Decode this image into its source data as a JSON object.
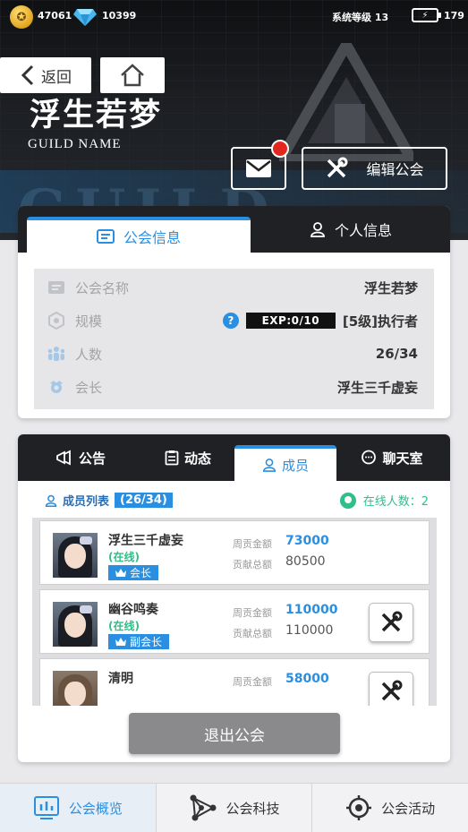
{
  "status_bar": {
    "coins": "47061",
    "gems": "10399",
    "system_level": "系统等级 13",
    "battery": "179"
  },
  "nav": {
    "back_label": "返回"
  },
  "guild": {
    "name": "浮生若梦",
    "subtitle": "GUILD NAME",
    "bg_word": "GUILD"
  },
  "header_actions": {
    "edit_label": "编辑公会"
  },
  "info_tabs": {
    "guild_info": "公会信息",
    "personal_info": "个人信息"
  },
  "info": {
    "name_label": "公会名称",
    "name_value": "浮生若梦",
    "scale_label": "规模",
    "exp_text": "EXP:0/10",
    "scale_value": "[5级]执行者",
    "members_label": "人数",
    "members_value": "26/34",
    "leader_label": "会长",
    "leader_value": "浮生三千虚妄"
  },
  "member_tabs": {
    "notice": "公告",
    "dynamic": "动态",
    "members": "成员",
    "chat": "聊天室"
  },
  "member_list": {
    "title": "成员列表",
    "count": "(26/34)",
    "online_label": "在线人数：2",
    "weekly_label": "周贡金额",
    "total_label": "贡献总额",
    "members": [
      {
        "name": "浮生三千虚妄",
        "status": "(在线)",
        "role": "会长",
        "weekly": "73000",
        "total": "80500"
      },
      {
        "name": "幽谷鸣奏",
        "status": "(在线)",
        "role": "副会长",
        "weekly": "110000",
        "total": "110000"
      },
      {
        "name": "清明",
        "status": "",
        "role": "",
        "weekly": "58000",
        "total": ""
      }
    ]
  },
  "quit_label": "退出公会",
  "bottom_nav": {
    "overview": "公会概览",
    "tech": "公会科技",
    "activity": "公会活动"
  },
  "colors": {
    "accent": "#2a8fe0",
    "online": "#2fbf88",
    "notification": "#e2271f",
    "dark_tabbar": "#1f2124"
  }
}
